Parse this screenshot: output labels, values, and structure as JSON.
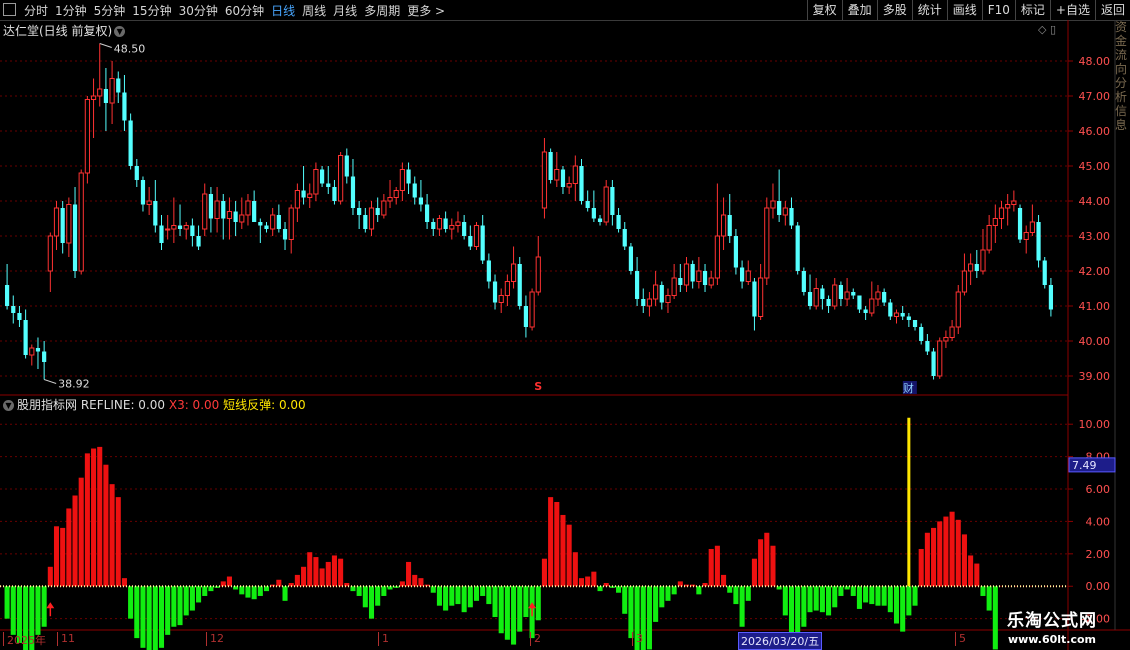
{
  "toolbar": {
    "periods": [
      "分时",
      "1分钟",
      "5分钟",
      "15分钟",
      "30分钟",
      "60分钟",
      "日线",
      "周线",
      "月线",
      "多周期",
      "更多 >"
    ],
    "active_period": "日线",
    "tools": [
      "复权",
      "叠加",
      "多股",
      "统计",
      "画线",
      "F10",
      "标记",
      "+自选",
      "返回"
    ]
  },
  "price_pane": {
    "title": "达仁堂(日线 前复权)",
    "max_label": "48.50",
    "min_label": "38.92",
    "marker_s": "S",
    "marker_cai": "财",
    "y_ticks": [
      "48.00",
      "47.00",
      "46.00",
      "45.00",
      "44.00",
      "43.00",
      "42.00",
      "41.00",
      "40.00",
      "39.00"
    ]
  },
  "indicator_pane": {
    "name": "股朋指标网",
    "fields": [
      {
        "label": "REFLINE:",
        "value": "0.00",
        "color": "#dcdcdc"
      },
      {
        "label": "X3:",
        "value": "0.00",
        "color": "#ff3a3a"
      },
      {
        "label": "短线反弹:",
        "value": "0.00",
        "color": "#ffe600"
      }
    ],
    "y_ticks": [
      "10.00",
      "8.00",
      "6.00",
      "4.00",
      "2.00",
      "0.00",
      "-2.00"
    ],
    "cursor_value": "7.49"
  },
  "date_axis": {
    "labels": [
      "2025年",
      "11",
      "12",
      "1",
      "2",
      "3",
      "5"
    ],
    "cursor_date": "2026/03/20/五"
  },
  "watermark": {
    "line1": "乐淘公式网",
    "line2": "www.60lt.com"
  },
  "side_strip": [
    "资",
    "金",
    "流",
    "向",
    "分",
    "析",
    "信",
    "息"
  ],
  "colors": {
    "up": "#ff3232",
    "down": "#54ffff",
    "bar_up": "#ee1111",
    "bar_down": "#11ee11",
    "signal": "#ffe600",
    "grid": "#6a0000",
    "axis": "#8b0000"
  },
  "chart_data": {
    "type": "candlestick",
    "ylim": [
      38.6,
      48.6
    ],
    "candles": [
      [
        41.6,
        42.2,
        40.9,
        41.0
      ],
      [
        41.0,
        41.3,
        40.5,
        40.8
      ],
      [
        40.8,
        41.0,
        40.4,
        40.6
      ],
      [
        40.6,
        40.9,
        39.5,
        39.6
      ],
      [
        39.6,
        39.9,
        39.3,
        39.8
      ],
      [
        39.8,
        40.1,
        39.2,
        39.7
      ],
      [
        39.7,
        40.0,
        38.9,
        39.4
      ],
      [
        42.0,
        43.1,
        41.4,
        43.0
      ],
      [
        43.0,
        44.0,
        42.6,
        43.8
      ],
      [
        43.8,
        44.0,
        42.5,
        42.8
      ],
      [
        42.8,
        44.1,
        42.4,
        43.9
      ],
      [
        43.9,
        44.4,
        41.8,
        42.0
      ],
      [
        42.0,
        44.9,
        41.9,
        44.8
      ],
      [
        44.8,
        47.0,
        44.5,
        46.9
      ],
      [
        46.9,
        47.5,
        45.8,
        47.0
      ],
      [
        47.0,
        48.5,
        46.7,
        47.2
      ],
      [
        47.2,
        47.8,
        46.0,
        46.8
      ],
      [
        46.8,
        48.0,
        46.2,
        47.5
      ],
      [
        47.5,
        47.7,
        46.8,
        47.1
      ],
      [
        47.1,
        47.6,
        46.0,
        46.3
      ],
      [
        46.3,
        46.5,
        44.9,
        45.0
      ],
      [
        45.0,
        45.2,
        44.4,
        44.6
      ],
      [
        44.6,
        44.7,
        43.7,
        43.9
      ],
      [
        43.9,
        44.4,
        43.6,
        44.0
      ],
      [
        44.0,
        44.6,
        43.1,
        43.3
      ],
      [
        43.3,
        43.6,
        42.6,
        42.8
      ],
      [
        43.2,
        43.6,
        42.9,
        43.2
      ],
      [
        43.2,
        44.1,
        42.8,
        43.3
      ],
      [
        43.3,
        43.9,
        43.0,
        43.2
      ],
      [
        43.2,
        43.4,
        42.9,
        43.3
      ],
      [
        43.3,
        43.5,
        42.7,
        43.0
      ],
      [
        43.0,
        43.3,
        42.6,
        42.7
      ],
      [
        43.2,
        44.5,
        43.0,
        44.2
      ],
      [
        44.2,
        44.4,
        43.1,
        43.5
      ],
      [
        43.5,
        44.4,
        43.1,
        44.0
      ],
      [
        44.0,
        44.2,
        42.9,
        43.5
      ],
      [
        43.5,
        44.1,
        42.9,
        43.7
      ],
      [
        43.7,
        44.0,
        43.0,
        43.4
      ],
      [
        43.4,
        44.1,
        43.2,
        43.6
      ],
      [
        43.6,
        44.2,
        43.3,
        44.0
      ],
      [
        44.0,
        44.3,
        43.4,
        43.4
      ],
      [
        43.4,
        43.5,
        42.8,
        43.3
      ],
      [
        43.3,
        43.4,
        43.1,
        43.2
      ],
      [
        43.2,
        43.8,
        43.0,
        43.6
      ],
      [
        43.6,
        43.9,
        43.1,
        43.2
      ],
      [
        43.2,
        43.4,
        42.6,
        42.9
      ],
      [
        42.9,
        43.9,
        42.5,
        43.8
      ],
      [
        43.8,
        44.5,
        43.4,
        44.3
      ],
      [
        44.3,
        45.0,
        43.9,
        44.1
      ],
      [
        44.1,
        44.5,
        43.8,
        44.2
      ],
      [
        44.2,
        45.1,
        44.0,
        44.9
      ],
      [
        44.9,
        45.0,
        44.4,
        44.5
      ],
      [
        44.5,
        45.0,
        44.2,
        44.4
      ],
      [
        44.4,
        44.6,
        43.9,
        44.0
      ],
      [
        44.0,
        45.4,
        43.9,
        45.3
      ],
      [
        45.3,
        45.5,
        44.5,
        44.7
      ],
      [
        44.7,
        45.2,
        43.6,
        43.8
      ],
      [
        43.8,
        44.0,
        43.2,
        43.6
      ],
      [
        43.6,
        43.8,
        43.1,
        43.2
      ],
      [
        43.2,
        44.0,
        43.0,
        43.8
      ],
      [
        43.8,
        44.1,
        43.4,
        43.6
      ],
      [
        43.6,
        44.2,
        43.5,
        44.0
      ],
      [
        44.0,
        44.6,
        43.8,
        44.1
      ],
      [
        44.1,
        44.4,
        43.9,
        44.3
      ],
      [
        44.3,
        45.1,
        44.0,
        44.9
      ],
      [
        44.9,
        45.1,
        44.2,
        44.5
      ],
      [
        44.5,
        44.7,
        43.9,
        44.1
      ],
      [
        44.1,
        44.6,
        43.7,
        43.9
      ],
      [
        43.9,
        44.2,
        43.2,
        43.4
      ],
      [
        43.4,
        43.5,
        43.0,
        43.2
      ],
      [
        43.2,
        43.6,
        43.0,
        43.5
      ],
      [
        43.5,
        43.7,
        43.1,
        43.2
      ],
      [
        43.2,
        43.5,
        42.9,
        43.3
      ],
      [
        43.3,
        43.7,
        43.1,
        43.4
      ],
      [
        43.4,
        43.6,
        42.9,
        43.0
      ],
      [
        43.0,
        43.3,
        42.6,
        42.7
      ],
      [
        42.7,
        43.4,
        42.6,
        43.3
      ],
      [
        43.3,
        43.6,
        42.2,
        42.3
      ],
      [
        42.3,
        42.5,
        41.5,
        41.7
      ],
      [
        41.7,
        41.9,
        40.9,
        41.1
      ],
      [
        41.1,
        41.5,
        40.8,
        41.3
      ],
      [
        41.3,
        41.9,
        41.0,
        41.7
      ],
      [
        41.7,
        42.7,
        41.5,
        42.2
      ],
      [
        42.2,
        42.4,
        40.9,
        41.0
      ],
      [
        41.0,
        41.3,
        40.1,
        40.4
      ],
      [
        40.4,
        41.5,
        40.3,
        41.4
      ],
      [
        41.4,
        43.0,
        41.3,
        42.4
      ],
      [
        43.8,
        45.8,
        43.5,
        45.4
      ],
      [
        45.4,
        45.5,
        44.5,
        44.6
      ],
      [
        44.6,
        45.4,
        44.4,
        44.9
      ],
      [
        44.9,
        45.0,
        44.2,
        44.4
      ],
      [
        44.4,
        44.7,
        44.2,
        44.5
      ],
      [
        44.5,
        45.3,
        44.0,
        45.0
      ],
      [
        45.0,
        45.2,
        43.9,
        44.0
      ],
      [
        44.0,
        44.3,
        43.7,
        43.8
      ],
      [
        43.8,
        44.3,
        43.4,
        43.5
      ],
      [
        43.5,
        43.6,
        43.3,
        43.4
      ],
      [
        43.4,
        44.6,
        43.3,
        44.4
      ],
      [
        44.4,
        44.6,
        43.3,
        43.6
      ],
      [
        43.6,
        43.8,
        43.1,
        43.2
      ],
      [
        43.2,
        43.4,
        42.6,
        42.7
      ],
      [
        42.7,
        42.8,
        41.9,
        42.0
      ],
      [
        42.0,
        42.4,
        41.0,
        41.2
      ],
      [
        41.2,
        41.5,
        40.8,
        41.0
      ],
      [
        41.0,
        41.4,
        40.7,
        41.2
      ],
      [
        41.2,
        42.0,
        41.0,
        41.6
      ],
      [
        41.6,
        41.7,
        40.9,
        41.1
      ],
      [
        41.1,
        41.5,
        40.8,
        41.3
      ],
      [
        41.3,
        42.2,
        41.2,
        41.8
      ],
      [
        41.8,
        42.2,
        41.4,
        41.6
      ],
      [
        41.6,
        42.4,
        41.4,
        42.2
      ],
      [
        42.2,
        42.3,
        41.5,
        41.7
      ],
      [
        41.7,
        42.4,
        41.5,
        42.0
      ],
      [
        42.0,
        42.2,
        41.4,
        41.6
      ],
      [
        41.6,
        42.0,
        41.5,
        41.8
      ],
      [
        41.8,
        44.5,
        41.6,
        43.0
      ],
      [
        43.0,
        44.1,
        42.6,
        43.6
      ],
      [
        43.6,
        44.2,
        42.8,
        43.0
      ],
      [
        43.0,
        43.2,
        41.9,
        42.1
      ],
      [
        42.1,
        42.3,
        41.5,
        41.7
      ],
      [
        41.7,
        42.3,
        41.6,
        42.0
      ],
      [
        41.7,
        41.8,
        40.3,
        40.7
      ],
      [
        40.7,
        42.2,
        40.6,
        41.8
      ],
      [
        41.8,
        44.1,
        41.6,
        43.8
      ],
      [
        43.8,
        44.5,
        43.5,
        44.0
      ],
      [
        44.0,
        44.9,
        43.4,
        43.6
      ],
      [
        43.6,
        44.0,
        43.3,
        43.8
      ],
      [
        43.8,
        44.1,
        43.2,
        43.3
      ],
      [
        43.3,
        43.4,
        41.9,
        42.0
      ],
      [
        42.0,
        42.1,
        41.3,
        41.4
      ],
      [
        41.4,
        41.9,
        40.9,
        41.0
      ],
      [
        41.0,
        41.8,
        40.9,
        41.5
      ],
      [
        41.5,
        41.6,
        40.9,
        41.2
      ],
      [
        41.2,
        41.3,
        40.8,
        41.0
      ],
      [
        41.0,
        41.8,
        40.9,
        41.6
      ],
      [
        41.6,
        41.7,
        41.0,
        41.2
      ],
      [
        41.2,
        41.8,
        41.0,
        41.4
      ],
      [
        41.4,
        41.5,
        41.2,
        41.3
      ],
      [
        41.3,
        41.3,
        40.8,
        40.9
      ],
      [
        40.9,
        41.0,
        40.6,
        40.8
      ],
      [
        40.8,
        41.7,
        40.7,
        41.2
      ],
      [
        41.2,
        41.6,
        41.0,
        41.4
      ],
      [
        41.4,
        41.5,
        41.0,
        41.1
      ],
      [
        41.1,
        41.2,
        40.6,
        40.7
      ],
      [
        40.7,
        40.9,
        40.5,
        40.8
      ],
      [
        40.8,
        41.0,
        40.6,
        40.7
      ],
      [
        40.7,
        40.8,
        40.4,
        40.6
      ],
      [
        40.6,
        40.6,
        40.3,
        40.4
      ],
      [
        40.4,
        40.5,
        39.9,
        40.0
      ],
      [
        40.0,
        40.2,
        39.6,
        39.7
      ],
      [
        39.7,
        39.8,
        38.9,
        39.0
      ],
      [
        39.0,
        40.1,
        38.92,
        40.0
      ],
      [
        40.0,
        40.3,
        39.8,
        40.1
      ],
      [
        40.1,
        40.6,
        40.0,
        40.4
      ],
      [
        40.4,
        41.6,
        40.2,
        41.4
      ],
      [
        41.4,
        42.5,
        41.3,
        42.0
      ],
      [
        42.0,
        42.5,
        41.6,
        42.2
      ],
      [
        42.2,
        42.6,
        41.8,
        42.0
      ],
      [
        42.0,
        43.2,
        41.9,
        42.6
      ],
      [
        42.6,
        43.6,
        42.5,
        43.3
      ],
      [
        43.3,
        43.9,
        42.8,
        43.5
      ],
      [
        43.5,
        44.0,
        43.2,
        43.8
      ],
      [
        43.8,
        44.2,
        43.3,
        43.9
      ],
      [
        43.9,
        44.3,
        43.7,
        44.0
      ],
      [
        43.8,
        43.9,
        42.8,
        42.9
      ],
      [
        42.9,
        43.3,
        42.5,
        43.1
      ],
      [
        43.1,
        43.9,
        43.0,
        43.4
      ],
      [
        43.4,
        43.6,
        42.1,
        42.3
      ],
      [
        42.3,
        42.4,
        41.5,
        41.6
      ],
      [
        41.6,
        41.8,
        40.7,
        40.9
      ]
    ],
    "indicator_bars": [
      -2,
      -3,
      -3.5,
      -4,
      -4,
      -3,
      -2.5,
      1.2,
      3.7,
      3.6,
      4.8,
      5.6,
      6.7,
      8.2,
      8.5,
      8.6,
      7.5,
      6.3,
      5.5,
      0.5,
      -2,
      -3.2,
      -3.8,
      -4.3,
      -4.5,
      -3.8,
      -3,
      -2.5,
      -2.4,
      -1.8,
      -1.5,
      -1,
      -0.6,
      -0.3,
      -0.1,
      0.3,
      0.6,
      -0.2,
      -0.5,
      -0.7,
      -0.8,
      -0.6,
      -0.3,
      0.1,
      0.4,
      -0.9,
      0.2,
      0.7,
      1.2,
      2.1,
      1.8,
      1.1,
      1.5,
      1.9,
      1.7,
      0.2,
      -0.3,
      -0.6,
      -1.3,
      -2,
      -1.2,
      -0.6,
      -0.2,
      -0.1,
      0.3,
      1.5,
      0.7,
      0.5,
      0.1,
      -0.4,
      -1.2,
      -1.5,
      -1.2,
      -1.1,
      -1.6,
      -1.3,
      -0.9,
      -0.6,
      -1.1,
      -1.9,
      -2.9,
      -3.3,
      -3.6,
      -2.8,
      -1.9,
      -3.2,
      -2.1,
      1.7,
      5.5,
      5.2,
      4.4,
      3.8,
      2.1,
      0.5,
      0.6,
      0.9,
      -0.3,
      0.2,
      -0.1,
      -0.4,
      -1.7,
      -3.2,
      -4,
      -4.4,
      -3.9,
      -2.2,
      -1.3,
      -0.9,
      -0.5,
      0.3,
      0.1,
      0.1,
      -0.5,
      0.2,
      2.3,
      2.5,
      0.7,
      -0.4,
      -1.1,
      -2.5,
      -0.9,
      1.7,
      2.9,
      3.3,
      2.5,
      -0.2,
      -1.8,
      -2.9,
      -3,
      -2.5,
      -1.6,
      -1.5,
      -1.6,
      -1.8,
      -1.3,
      -0.6,
      -0.2,
      -0.6,
      -1.4,
      -1,
      -1.1,
      -1.2,
      -1.2,
      -1.6,
      -2.3,
      -2.8,
      -1.8,
      -1.2,
      2.3,
      3.3,
      3.6,
      4,
      4.3,
      4.6,
      4.1,
      3.2,
      1.9,
      1.4,
      -0.6,
      -1.5,
      -3.9
    ],
    "signal_index": 146,
    "signal_value": 10.4,
    "up_arrows": [
      7,
      85
    ],
    "indicator_ylim": [
      -2.7,
      11
    ]
  }
}
